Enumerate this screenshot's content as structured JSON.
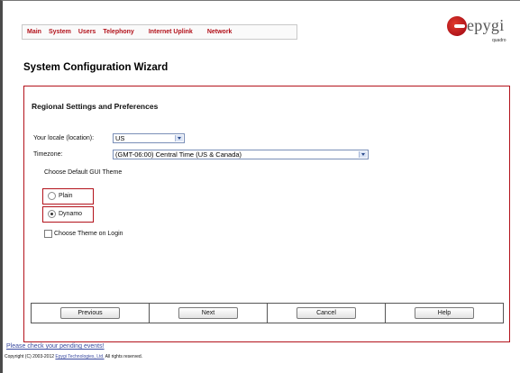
{
  "nav": {
    "items": [
      "Main",
      "System",
      "Users",
      "Telephony",
      "Internet Uplink",
      "Network"
    ]
  },
  "logo": {
    "brand": "epygi",
    "subtitle": "quadro"
  },
  "page_title": "System Configuration Wizard",
  "section": {
    "title": "Regional Settings and Preferences",
    "locale_label": "Your locale (location):",
    "locale_value": "US",
    "timezone_label": "Timezone:",
    "timezone_value": "(GMT-06:00) Central Time (US & Canada)",
    "theme_heading": "Choose Default GUI Theme",
    "theme_options": [
      {
        "label": "Plain",
        "checked": false
      },
      {
        "label": "Dynamo",
        "checked": true
      }
    ],
    "choose_theme_login_label": "Choose Theme on Login",
    "choose_theme_login_checked": false
  },
  "buttons": {
    "previous": "Previous",
    "next": "Next",
    "cancel": "Cancel",
    "help": "Help"
  },
  "footer": {
    "pending_link": "Please check your pending events!",
    "copyright_prefix": "Copyright (C) 2003-2012",
    "copyright_link": "Epygi Technologies, Ltd.",
    "copyright_suffix": "All rights reserved."
  },
  "colors": {
    "accent": "#b3121b",
    "link": "#3a4aa0"
  }
}
